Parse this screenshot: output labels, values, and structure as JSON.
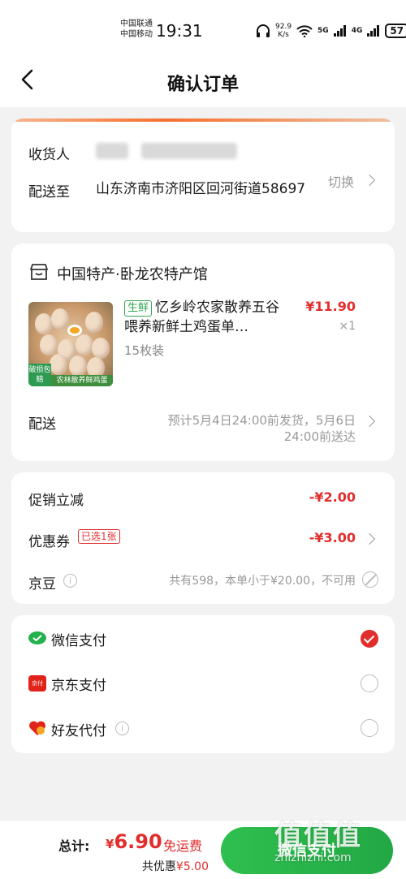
{
  "status_bar": {
    "carrier_1": "中国联通",
    "carrier_2": "中国移动",
    "time": "19:31",
    "net_speed_value": "92.9",
    "net_speed_unit": "K/s",
    "signal_1": "5G",
    "signal_2": "4G",
    "battery": "57"
  },
  "nav": {
    "title": "确认订单"
  },
  "address": {
    "receiver_label": "收货人",
    "deliver_to_label": "配送至",
    "address_line": "山东济南市济阳区回河街道58697",
    "switch_label": "切换"
  },
  "shop": {
    "name": "中国特产·卧龙农特产馆",
    "product": {
      "fresh_tag": "生鲜",
      "title": "忆乡岭农家散养五谷喂养新鲜土鸡蛋单…",
      "spec": "15枚装",
      "price": "¥11.90",
      "qty": "×1",
      "badge_broken": "破损包赔",
      "banner": "农林散养鲜鸡蛋"
    },
    "shipping_label": "配送",
    "shipping_text": "预计5月4日24:00前发货，5月6日24:00前送达"
  },
  "promo": {
    "discount_label": "促销立减",
    "discount_value": "-¥2.00",
    "coupon_label": "优惠券",
    "coupon_tag": "已选1张",
    "coupon_value": "-¥3.00",
    "bean_label": "京豆",
    "bean_text": "共有598，本单小于¥20.00，不可用"
  },
  "payment": {
    "options": [
      {
        "label": "微信支付",
        "selected": true
      },
      {
        "label": "京东支付",
        "selected": false
      },
      {
        "label": "好友代付",
        "selected": false
      }
    ],
    "jd_icon_text": "京付"
  },
  "footer": {
    "total_label": "总计:",
    "currency": "¥",
    "total_value": "6.90",
    "free_shipping": "免运费",
    "save_prefix": "共优惠",
    "save_value": "¥5.00",
    "pay_button": "微信支付"
  },
  "watermark": {
    "logo": "值值值",
    "url": "zhizhizhi.com"
  },
  "colors": {
    "accent_red": "#e22d2d",
    "wechat_green": "#22a845",
    "page_bg": "#f2f2f2"
  }
}
